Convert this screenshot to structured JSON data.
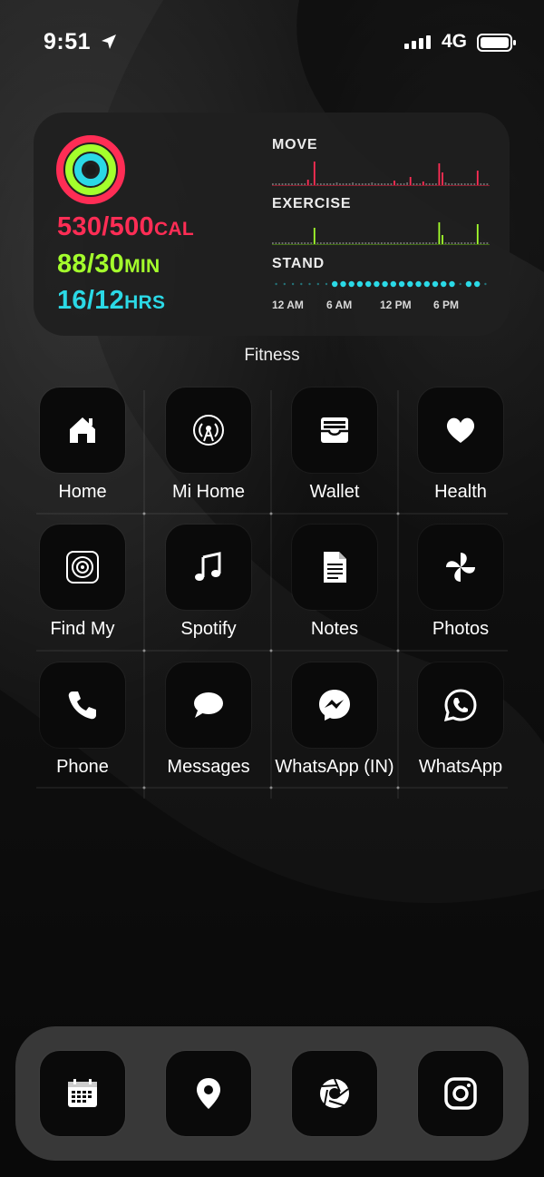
{
  "status_bar": {
    "time": "9:51",
    "network": "4G",
    "icons": [
      "location-arrow-icon",
      "cellular-signal-icon",
      "battery-icon"
    ]
  },
  "fitness_widget": {
    "move": {
      "value": "530/500",
      "unit": "CAL",
      "color": "#ff2d55"
    },
    "exercise": {
      "value": "88/30",
      "unit": "MIN",
      "color": "#a4ff2c"
    },
    "stand": {
      "value": "16/12",
      "unit": "HRS",
      "color": "#2bd9e6"
    },
    "charts": {
      "move_label": "MOVE",
      "exercise_label": "EXERCISE",
      "stand_label": "STAND",
      "time_labels": [
        "12 AM",
        "6 AM",
        "12 PM",
        "6 PM"
      ]
    },
    "label": "Fitness"
  },
  "apps": [
    {
      "label": "Home",
      "icon": "house-icon"
    },
    {
      "label": "Mi Home",
      "icon": "antenna-icon"
    },
    {
      "label": "Wallet",
      "icon": "wallet-icon"
    },
    {
      "label": "Health",
      "icon": "heart-icon"
    },
    {
      "label": "Find My",
      "icon": "radar-icon"
    },
    {
      "label": "Spotify",
      "icon": "music-note-icon"
    },
    {
      "label": "Notes",
      "icon": "document-icon"
    },
    {
      "label": "Photos",
      "icon": "pinwheel-icon"
    },
    {
      "label": "Phone",
      "icon": "phone-icon"
    },
    {
      "label": "Messages",
      "icon": "speech-bubble-icon"
    },
    {
      "label": "WhatsApp (IN)",
      "icon": "messenger-icon"
    },
    {
      "label": "WhatsApp",
      "icon": "whatsapp-icon"
    }
  ],
  "dock": [
    {
      "icon": "calendar-icon"
    },
    {
      "icon": "map-pin-icon"
    },
    {
      "icon": "camera-aperture-icon"
    },
    {
      "icon": "instagram-icon"
    }
  ]
}
